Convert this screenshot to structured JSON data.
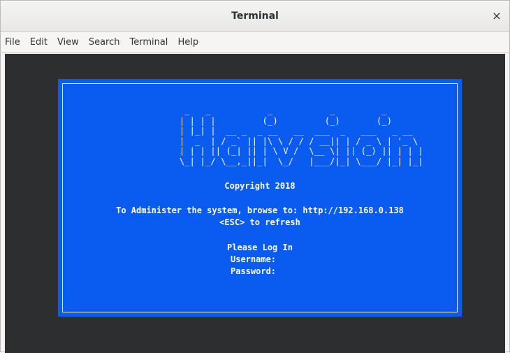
{
  "window": {
    "title": "Terminal",
    "close_glyph": "×"
  },
  "menubar": {
    "items": [
      "File",
      "Edit",
      "View",
      "Search",
      "Terminal",
      "Help"
    ]
  },
  "console": {
    "logo_text": "          _   _           _           _         _                          \n         | | | |         (_)         (_)       (_)                         \n         | |_| |  __ _  _ __   __  ___  _   ___   _ __                     \n         |  _  | / _` || |\\ \\ / / / __|| | / _ \\ | '_ \\                    \n         | | | || (_| || | \\ V /  \\__ \\| || (_) || | | |                   \n         \\_| |_/ \\__,_||_|  \\_/   |___/|_| \\___/ |_| |_|                   ",
    "copyright": "Copyright 2018",
    "admin_line": "To Administer the system, browse to: http://192.168.0.138",
    "refresh_line": "<ESC> to refresh",
    "login_prompt": "Please Log In",
    "username_label": "Username:",
    "password_label": "Password:",
    "colors": {
      "dialog_bg": "#0a5cf0",
      "terminal_bg": "#2c2e30",
      "text": "#ffffff"
    }
  }
}
